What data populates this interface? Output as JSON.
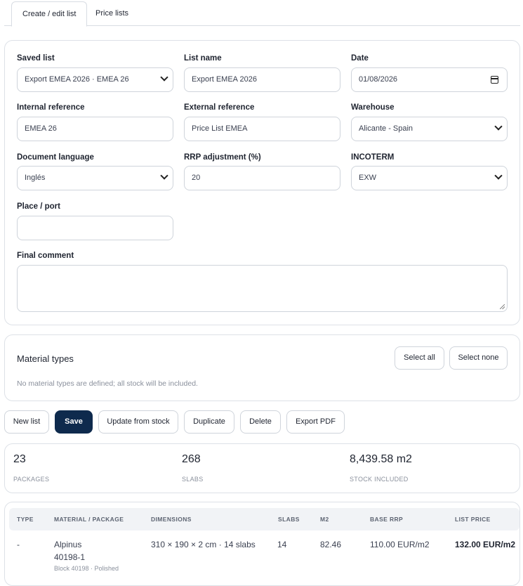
{
  "tabs": [
    {
      "label": "Create / edit list"
    },
    {
      "label": "Price lists"
    }
  ],
  "form": {
    "saved_list": {
      "label": "Saved list",
      "value": "Export EMEA 2026 · EMEA 26"
    },
    "list_name": {
      "label": "List name",
      "value": "Export EMEA 2026"
    },
    "date": {
      "label": "Date",
      "value": "01/08/2026"
    },
    "internal_reference": {
      "label": "Internal reference",
      "value": "EMEA 26"
    },
    "external_reference": {
      "label": "External reference",
      "value": "Price List EMEA"
    },
    "warehouse": {
      "label": "Warehouse",
      "value": "Alicante - Spain"
    },
    "document_language": {
      "label": "Document language",
      "value": "Inglés"
    },
    "rrp_adjustment": {
      "label": "RRP adjustment (%)",
      "value": "20"
    },
    "incoterm": {
      "label": "INCOTERM",
      "value": "EXW"
    },
    "place_port": {
      "label": "Place / port",
      "value": ""
    },
    "final_comment": {
      "label": "Final comment",
      "value": ""
    }
  },
  "material_types": {
    "title": "Material types",
    "select_all": "Select all",
    "select_none": "Select none",
    "note": "No material types are defined; all stock will be included."
  },
  "actions": {
    "new_list": "New list",
    "save": "Save",
    "update_from_stock": "Update from stock",
    "duplicate": "Duplicate",
    "delete": "Delete",
    "export_pdf": "Export PDF"
  },
  "stats": [
    {
      "value": "23",
      "label": "PACKAGES"
    },
    {
      "value": "268",
      "label": "SLABS"
    },
    {
      "value": "8,439.58 m2",
      "label": "STOCK INCLUDED"
    }
  ],
  "table": {
    "headers": [
      "TYPE",
      "MATERIAL / PACKAGE",
      "DIMENSIONS",
      "SLABS",
      "M2",
      "BASE RRP",
      "LIST PRICE"
    ],
    "rows": [
      {
        "type": "-",
        "material": "Alpinus",
        "package": "40198-1",
        "detail": "Block 40198 · Polished",
        "dimensions": "310 × 190 × 2 cm · 14 slabs",
        "slabs": "14",
        "m2": "82.46",
        "base_rrp": "110.00 EUR/m2",
        "list_price": "132.00 EUR/m2"
      }
    ]
  },
  "colors": {
    "primary": "#0e2a4d",
    "border": "#dde1e7",
    "muted": "#8a909c"
  }
}
